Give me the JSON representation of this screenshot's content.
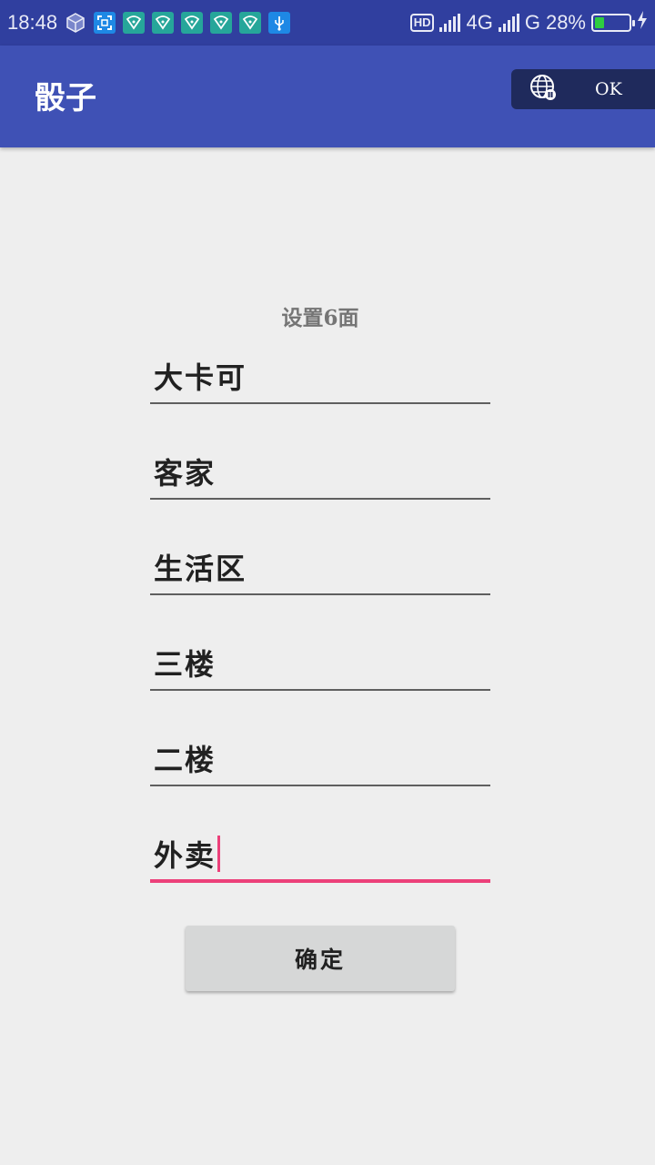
{
  "status_bar": {
    "time": "18:48",
    "hd": "HD",
    "network1": "4G",
    "network2": "G",
    "battery_percent": "28%",
    "battery_level": 0.28,
    "icons": [
      "app-cube-icon",
      "screenshot-icon",
      "wifi-shield-icon",
      "wifi-shield-icon",
      "wifi-shield-icon",
      "wifi-shield-icon",
      "wifi-shield-icon",
      "usb-icon"
    ]
  },
  "app_bar": {
    "title": "骰子",
    "color": "#3f51b5"
  },
  "vpn": {
    "label": "OK",
    "icon": "globe-icon"
  },
  "form": {
    "title": "设置6面",
    "fields": [
      "大卡可",
      "客家",
      "生活区",
      "三楼",
      "二楼",
      "外卖"
    ],
    "focused_index": 5,
    "accent_color": "#ec407a",
    "confirm_label": "确定"
  }
}
